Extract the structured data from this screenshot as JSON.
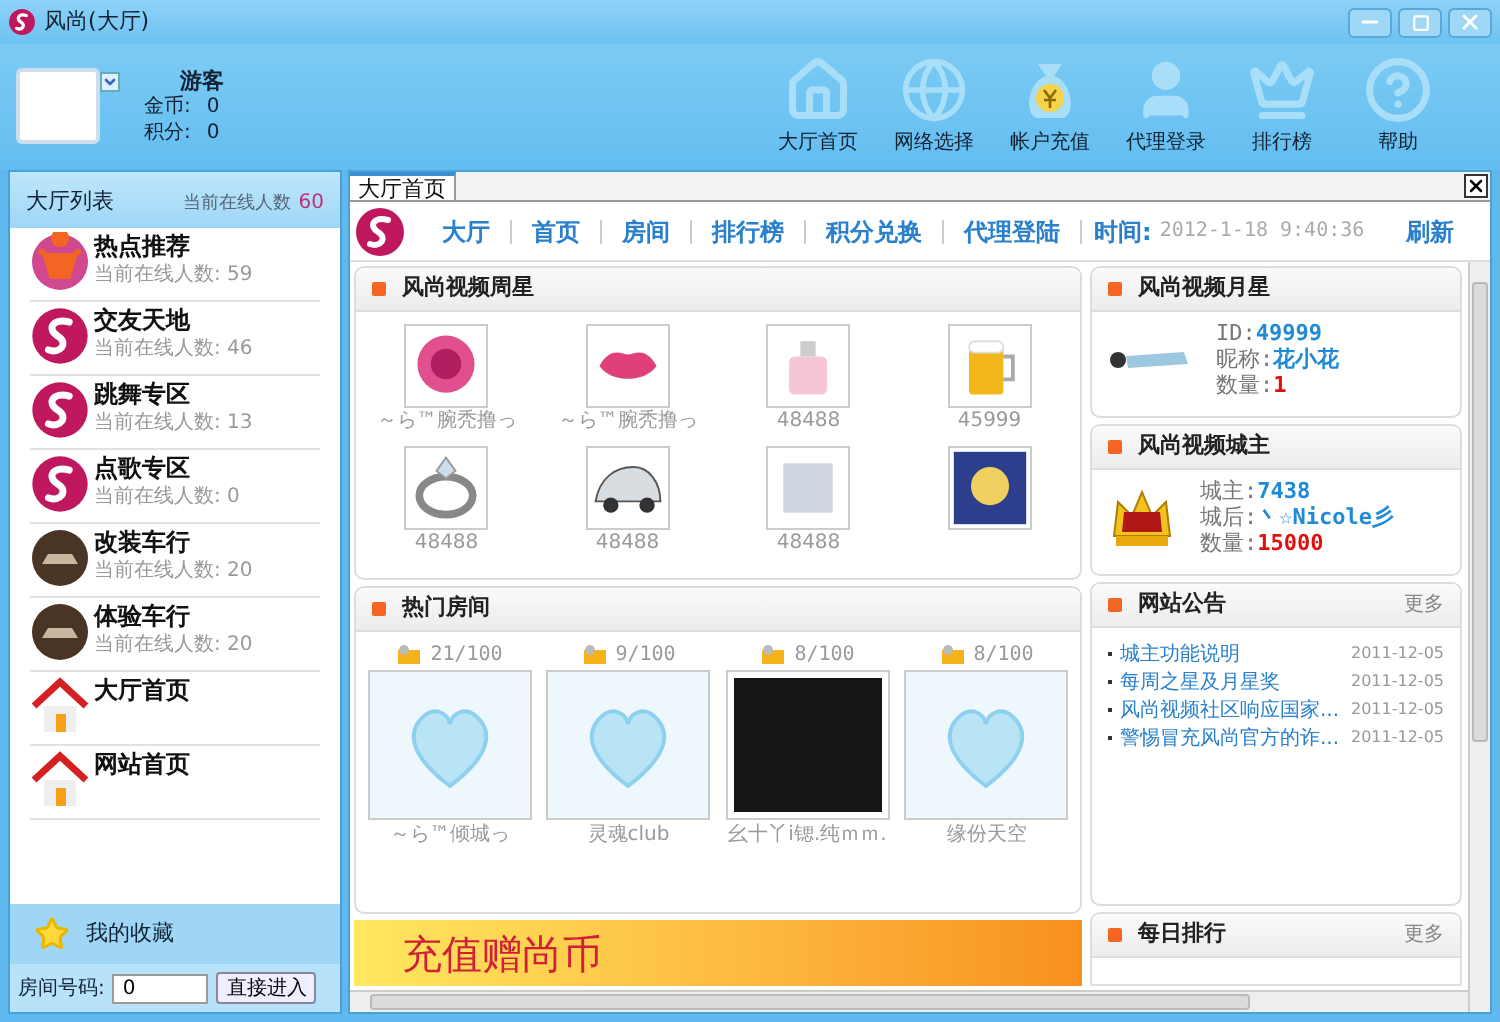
{
  "window": {
    "title": "风尚(大厅)"
  },
  "user": {
    "name": "游客",
    "coins_label": "金币:",
    "coins": "0",
    "points_label": "积分:",
    "points": "0"
  },
  "toolbar": [
    {
      "kind": "home",
      "label": "大厅首页"
    },
    {
      "kind": "globe",
      "label": "网络选择"
    },
    {
      "kind": "money",
      "label": "帐户充值"
    },
    {
      "kind": "user",
      "label": "代理登录"
    },
    {
      "kind": "crown",
      "label": "排行榜"
    },
    {
      "kind": "help",
      "label": "帮助"
    }
  ],
  "sidebar": {
    "title": "大厅列表",
    "online_label": "当前在线人数",
    "online": "60",
    "items": [
      {
        "kind": "hot",
        "name": "热点推荐",
        "count": "当前在线人数: 59"
      },
      {
        "kind": "logo",
        "name": "交友天地",
        "count": "当前在线人数: 46"
      },
      {
        "kind": "logo",
        "name": "跳舞专区",
        "count": "当前在线人数: 13"
      },
      {
        "kind": "logo",
        "name": "点歌专区",
        "count": "当前在线人数: 0"
      },
      {
        "kind": "car",
        "name": "改装车行",
        "count": "当前在线人数: 20"
      },
      {
        "kind": "car",
        "name": "体验车行",
        "count": "当前在线人数: 20"
      },
      {
        "kind": "home",
        "name": "大厅首页"
      },
      {
        "kind": "home",
        "name": "网站首页"
      }
    ],
    "favorites": "我的收藏",
    "room_label": "房间号码:",
    "room_value": "0",
    "enter_button": "直接进入"
  },
  "tab": {
    "label": "大厅首页"
  },
  "nav": {
    "items": [
      {
        "label": "大厅"
      },
      {
        "label": "首页"
      },
      {
        "label": "房间"
      },
      {
        "label": "排行榜"
      },
      {
        "label": "积分兑换"
      },
      {
        "label": "代理登陆"
      }
    ],
    "time_label": "时间:",
    "time": "2012-1-18 9:40:36",
    "refresh": "刷新"
  },
  "weekly_stars": {
    "title": "风尚视频周星",
    "gifts": [
      {
        "kind": "rose",
        "label": "～ら™腕秃撸っ"
      },
      {
        "kind": "lips",
        "label": "～ら™腕秃撸っ"
      },
      {
        "kind": "perfume",
        "label": "48488"
      },
      {
        "kind": "beer",
        "label": "45999"
      },
      {
        "kind": "ring",
        "label": "48488"
      },
      {
        "kind": "car",
        "label": "48488"
      },
      {
        "kind": "other",
        "label": "48488"
      },
      {
        "kind": "poster"
      }
    ]
  },
  "hot_rooms": {
    "title": "热门房间",
    "rooms": [
      {
        "kind": "heart",
        "count": "21/100",
        "name": "～ら™倾城っ"
      },
      {
        "kind": "heart",
        "count": "9/100",
        "name": "灵魂club"
      },
      {
        "kind": "photo",
        "count": "8/100",
        "name": "幺十丫i锶.纯ｍｍ."
      },
      {
        "kind": "heart",
        "count": "8/100",
        "name": "缘份天空"
      }
    ]
  },
  "banner": {
    "text": "充值赠尚币"
  },
  "monthly_star": {
    "title": "风尚视频月星",
    "fields": [
      {
        "label": "ID:",
        "value": "49999",
        "kind": "id"
      },
      {
        "label": "昵称:",
        "value": "花小花",
        "kind": "name"
      },
      {
        "label": "数量:",
        "value": "1",
        "kind": "amount"
      }
    ]
  },
  "city_lord": {
    "title": "风尚视频城主",
    "fields": [
      {
        "label": "城主:",
        "value": "7438",
        "kind": "id"
      },
      {
        "label": "城后:",
        "value": "丶☆Nicole彡",
        "kind": "name"
      },
      {
        "label": "数量:",
        "value": "15000",
        "kind": "amount"
      }
    ]
  },
  "notices": {
    "title": "网站公告",
    "more": "更多",
    "items": [
      {
        "title": "城主功能说明",
        "date": "2011-12-05"
      },
      {
        "title": "每周之星及月星奖",
        "date": "2011-12-05"
      },
      {
        "title": "风尚视频社区响应国家...",
        "date": "2011-12-05"
      },
      {
        "title": "警惕冒充风尚官方的诈...",
        "date": "2011-12-05"
      }
    ]
  },
  "daily_rank": {
    "title": "每日排行",
    "more": "更多"
  }
}
